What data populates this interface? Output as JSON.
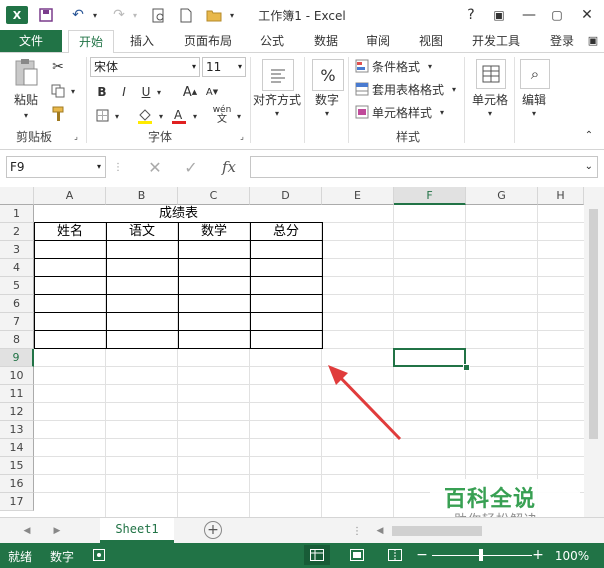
{
  "app": {
    "title": "工作簿1 - Excel",
    "window_controls": [
      "?",
      "▢",
      "—",
      "▢",
      "✕"
    ]
  },
  "tabs": [
    "文件",
    "开始",
    "插入",
    "页面布局",
    "公式",
    "数据",
    "审阅",
    "视图",
    "开发工具",
    "登录"
  ],
  "ribbon": {
    "clipboard": {
      "paste": "粘贴",
      "group": "剪贴板"
    },
    "font": {
      "name": "宋体",
      "size": "11",
      "bold": "B",
      "italic": "I",
      "underline": "U",
      "grow": "A",
      "shrink": "A",
      "wen": "wén",
      "group": "字体"
    },
    "alignment": {
      "label": "对齐方式"
    },
    "number": {
      "label": "数字",
      "symbol": "%"
    },
    "styles": {
      "conditional": "条件格式",
      "table": "套用表格格式",
      "cell": "单元格样式",
      "group": "样式"
    },
    "cells": {
      "label": "单元格"
    },
    "editing": {
      "label": "编辑"
    }
  },
  "formula_bar": {
    "name_box": "F9",
    "fx": "fx",
    "value": ""
  },
  "sheet": {
    "columns": [
      "A",
      "B",
      "C",
      "D",
      "E",
      "F",
      "G",
      "H"
    ],
    "rows": [
      "1",
      "2",
      "3",
      "4",
      "5",
      "6",
      "7",
      "8",
      "9",
      "10",
      "11",
      "12",
      "13",
      "14",
      "15",
      "16",
      "17"
    ],
    "selected_cell": "F9",
    "title_cell": "成绩表",
    "headers": [
      "姓名",
      "语文",
      "数学",
      "总分"
    ]
  },
  "sheet_tabs": {
    "active": "Sheet1",
    "add": "+"
  },
  "status": {
    "ready": "就绪",
    "mode": "数字",
    "zoom": "100%"
  },
  "watermark": {
    "title": "百科全说",
    "subtitle": "助你轻松解决"
  },
  "colors": {
    "excel_green": "#217346",
    "arrow_red": "#e03c3c"
  }
}
